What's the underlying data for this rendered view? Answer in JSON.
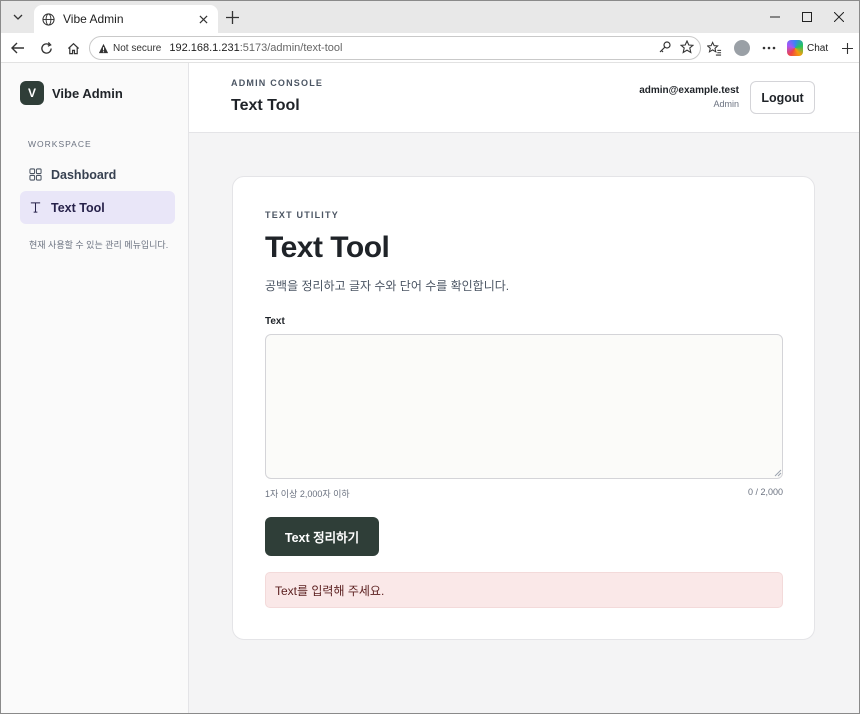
{
  "browser": {
    "tab_title": "Vibe Admin",
    "security_label": "Not secure",
    "url_host": "192.168.1.231",
    "url_path": ":5173/admin/text-tool",
    "chat_label": "Chat"
  },
  "sidebar": {
    "brand_initial": "V",
    "brand_name": "Vibe Admin",
    "section_label": "WORKSPACE",
    "items": [
      {
        "label": "Dashboard",
        "icon": "grid-icon",
        "active": false
      },
      {
        "label": "Text Tool",
        "icon": "text-icon",
        "active": true
      }
    ],
    "note": "현재 사용할 수 있는 관리 메뉴입니다."
  },
  "header": {
    "eyebrow": "ADMIN CONSOLE",
    "title": "Text Tool",
    "user_email": "admin@example.test",
    "user_role": "Admin",
    "logout_label": "Logout"
  },
  "card": {
    "eyebrow": "TEXT UTILITY",
    "title": "Text Tool",
    "description": "공백을 정리하고 글자 수와 단어 수를 확인합니다.",
    "field_label": "Text",
    "textarea_value": "",
    "hint_left": "1자 이상 2,000자 이하",
    "hint_right": "0 / 2,000",
    "submit_label": "Text 정리하기",
    "error_message": "Text를 입력해 주세요."
  },
  "colors": {
    "brand": "#2f3e38",
    "active_nav_bg": "#e9e6f8",
    "alert_bg": "#fae8e8"
  }
}
